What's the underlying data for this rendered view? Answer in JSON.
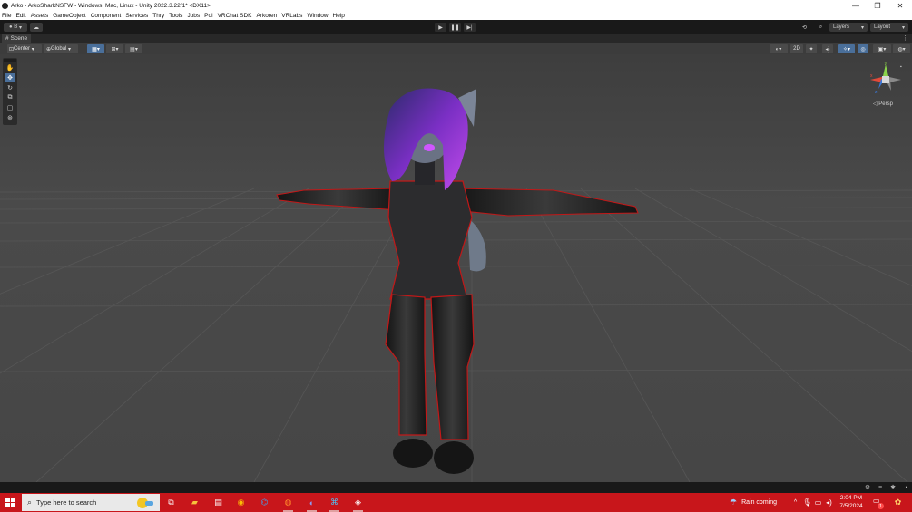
{
  "window": {
    "title": "Arko - ArkoSharkNSFW - Windows, Mac, Linux - Unity 2022.3.22f1* <DX11>",
    "minimize": "—",
    "restore": "❐",
    "close": "✕"
  },
  "menu": [
    "File",
    "Edit",
    "Assets",
    "GameObject",
    "Component",
    "Services",
    "Thry",
    "Tools",
    "Jobs",
    "Poi",
    "VRChat SDK",
    "Arkoren",
    "VRLabs",
    "Window",
    "Help"
  ],
  "toolbar": {
    "account_label": "B",
    "layers_label": "Layers",
    "layout_label": "Layout"
  },
  "scene_tab": {
    "label": "Scene"
  },
  "scene_toolbar": {
    "pivot_label": "Center",
    "space_label": "Global",
    "mode_2d_label": "2D"
  },
  "gizmo": {
    "persp_label": "◁ Persp",
    "axis_y": "y",
    "axis_x": "x",
    "axis_z": "z"
  },
  "taskbar": {
    "search_placeholder": "Type here to search",
    "weather_text": "Rain coming",
    "time": "2:04 PM",
    "date": "7/5/2024",
    "notification_count": "1"
  },
  "icons": {
    "play": "play-icon",
    "pause": "pause-icon",
    "step": "step-icon"
  },
  "colors": {
    "taskbar": "#c8161b",
    "viewport": "#454545",
    "accent": "#4a6f9a"
  }
}
